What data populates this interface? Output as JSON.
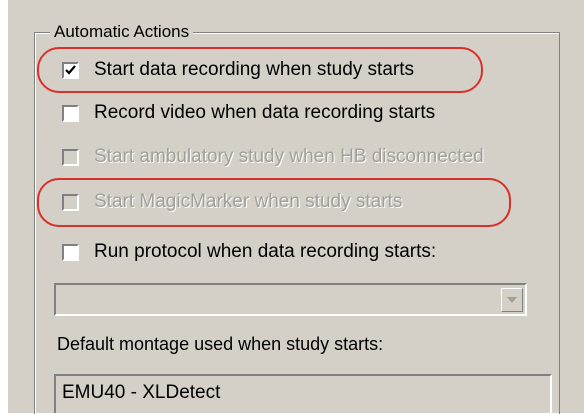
{
  "group": {
    "title": "Automatic Actions"
  },
  "options": [
    {
      "label": "Start data recording when study starts",
      "checked": true,
      "disabled": false,
      "highlighted": true
    },
    {
      "label": "Record video when data recording starts",
      "checked": false,
      "disabled": false,
      "highlighted": false
    },
    {
      "label": "Start ambulatory study when HB disconnected",
      "checked": false,
      "disabled": true,
      "highlighted": false
    },
    {
      "label": "Start MagicMarker when study starts",
      "checked": false,
      "disabled": true,
      "highlighted": true
    },
    {
      "label": "Run protocol when data recording starts:",
      "checked": false,
      "disabled": false,
      "highlighted": false
    }
  ],
  "protocol_select": {
    "value": "",
    "disabled": true
  },
  "montage": {
    "label": "Default montage used when study starts:",
    "value": "EMU40 - XLDetect"
  },
  "colors": {
    "panel": "#d4d0c8",
    "highlight_ring": "#d8302a",
    "disabled_text": "#a19f98"
  },
  "icons": {
    "check": "check-icon",
    "dropdown": "chevron-down-icon"
  }
}
